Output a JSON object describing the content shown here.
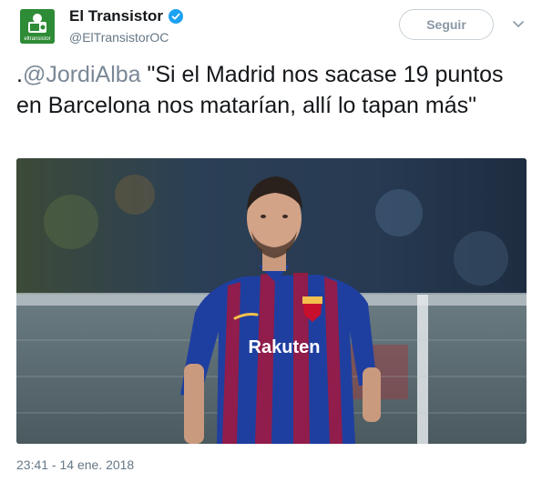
{
  "author": {
    "display_name": "El Transistor",
    "handle": "@ElTransistorOC",
    "avatar_text": "eltransistor",
    "verified_icon": "verified-badge-icon"
  },
  "actions": {
    "follow_label": "Seguir",
    "caret_icon": "chevron-down-icon"
  },
  "tweet": {
    "mention": "@JordiAlba",
    "prefix": ".",
    "body": " \"Si el Madrid nos sacase 19 puntos en Barcelona nos matarían, allí lo tapan más\"",
    "timestamp": "23:41 - 14 ene. 2018"
  },
  "photo": {
    "jersey_sponsor": "Rakuten",
    "crest": "FCB"
  },
  "colors": {
    "brand_green": "#2e8b36",
    "verified_blue": "#1da1f2",
    "jersey_blue": "#1f3fa0",
    "jersey_red": "#a5173c"
  }
}
